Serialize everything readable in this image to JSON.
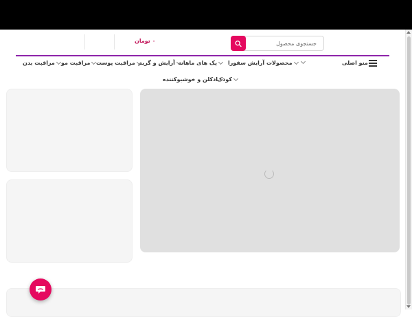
{
  "header": {
    "search": {
      "placeholder": "جستجوی محصول",
      "value": ""
    },
    "price": "۰ تومان"
  },
  "nav": {
    "main_menu_label": "منو اصلی",
    "items": [
      {
        "label": "مراقبت بدن"
      },
      {
        "label": "مراقبت مو"
      },
      {
        "label": "مراقبت پوست"
      },
      {
        "label": "آرایش و گریم"
      },
      {
        "label": "پک های ماهانه"
      },
      {
        "label": "محصولات آرایش سفورا"
      },
      {
        "label": "کودک"
      },
      {
        "label": "ادکلن و خوشبوکننده"
      }
    ]
  },
  "icons": {
    "search": "search-icon",
    "menu": "hamburger-icon",
    "chat": "chat-icon",
    "chevron": "chevron-down-icon",
    "loading": "loading-spinner"
  },
  "colors": {
    "accent": "#e5095f",
    "divider": "#8e24aa",
    "topbar": "#000000",
    "placeholder_block": "#e0e0e0"
  }
}
